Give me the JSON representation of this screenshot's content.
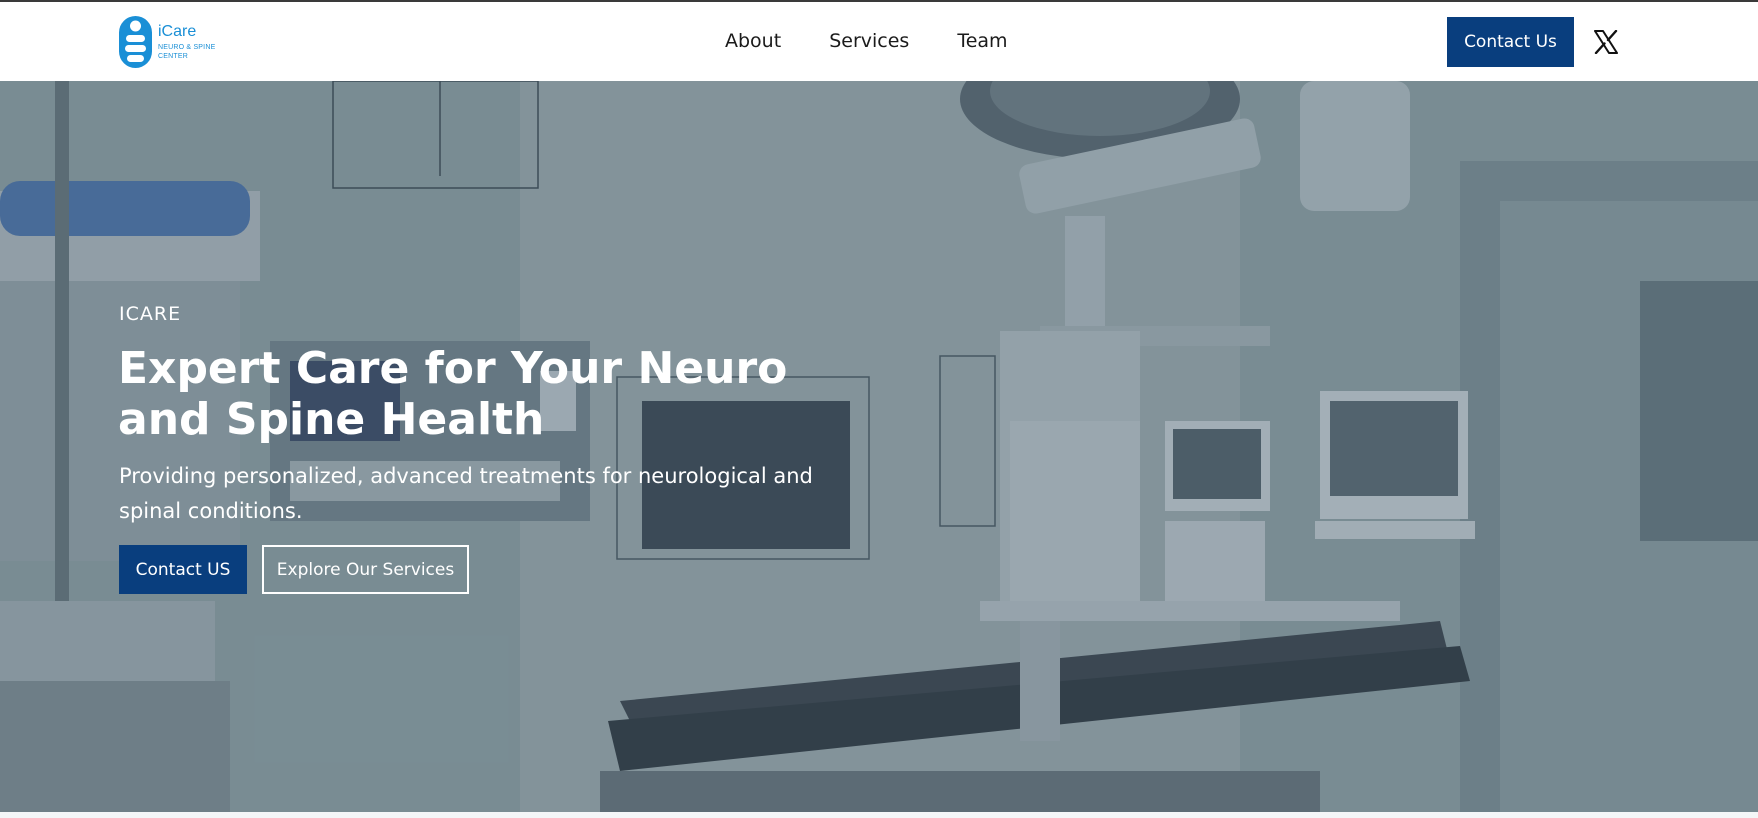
{
  "brand": {
    "name": "iCare",
    "subtitle_line1": "NEURO & SPINE",
    "subtitle_line2": "CENTER",
    "logo_icon": "spine-logo-icon",
    "color": "#1a8fd6"
  },
  "nav": {
    "items": [
      {
        "label": "About"
      },
      {
        "label": "Services"
      },
      {
        "label": "Team"
      }
    ]
  },
  "header": {
    "contact_label": "Contact Us",
    "social_icon": "x-icon"
  },
  "hero": {
    "eyebrow": "ICARE",
    "title": "Expert Care for Your Neuro and Spine Health",
    "subtitle": "Providing personalized, advanced treatments for neurological and spinal conditions.",
    "primary_label": "Contact US",
    "secondary_label": "Explore Our Services",
    "background": "operating-room-photo"
  },
  "colors": {
    "primary": "#093e7e",
    "overlay": "#3c5264",
    "text_light": "#ffffff"
  }
}
